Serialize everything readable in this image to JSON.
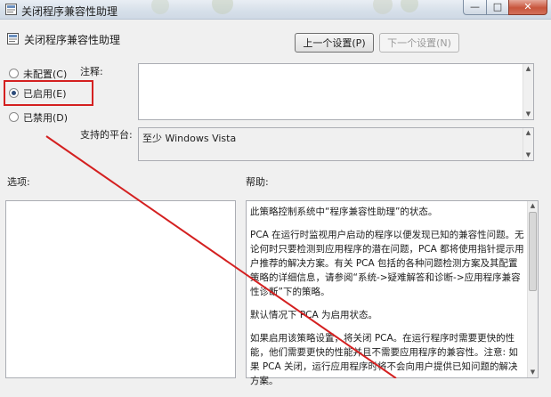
{
  "window": {
    "title": "关闭程序兼容性助理",
    "minimize_glyph": "—",
    "maximize_glyph": "□",
    "close_glyph": "✕"
  },
  "policy": {
    "title": "关闭程序兼容性助理",
    "icon": "policy-setting-icon"
  },
  "nav": {
    "prev_label": "上一个设置(P)",
    "next_label": "下一个设置(N)"
  },
  "state": {
    "options": [
      {
        "label": "未配置(C)",
        "checked": false
      },
      {
        "label": "已启用(E)",
        "checked": true
      },
      {
        "label": "已禁用(D)",
        "checked": false
      }
    ]
  },
  "comment": {
    "label": "注释:",
    "value": ""
  },
  "platform": {
    "label": "支持的平台:",
    "value": "至少 Windows Vista"
  },
  "options_section": {
    "label": "选项:"
  },
  "help_section": {
    "label": "帮助:",
    "paragraphs": [
      "此策略控制系统中“程序兼容性助理”的状态。",
      "PCA 在运行时监视用户启动的程序以便发现已知的兼容性问题。无论何时只要检测到应用程序的潜在问题，PCA 都将使用指针提示用户推荐的解决方案。有关 PCA 包括的各种问题检测方案及其配置策略的详细信息，请参阅“系统->疑难解答和诊断->应用程序兼容性诊断”下的策略。",
      "默认情况下 PCA 为启用状态。",
      "如果启用该策略设置，将关闭 PCA。在运行程序时需要更快的性能，他们需要更快的性能并且不需要应用程序的兼容性。注意: 如果 PCA 关闭，运行应用程序时将不会向用户提供已知问题的解决方案。"
    ]
  },
  "annotation": {
    "highlight_color": "#d42020",
    "arrow_color": "#d42020"
  }
}
